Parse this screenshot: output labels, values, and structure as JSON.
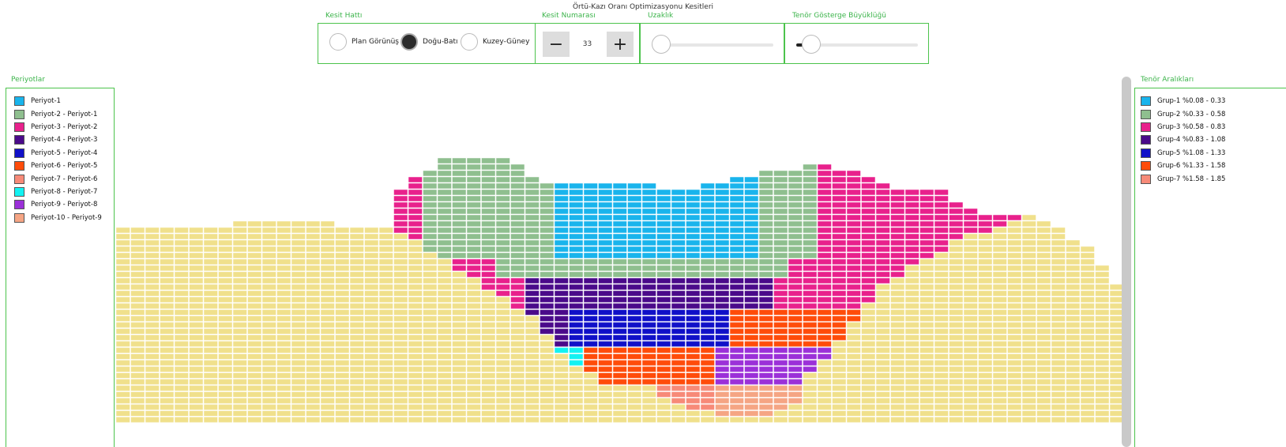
{
  "title": "Örtü-Kazı Oranı Optimizasyonu Kesitleri",
  "toolbar": {
    "section_line_label": "Kesit Hattı",
    "section_number_label": "Kesit Numarası",
    "distance_label": "Uzaklık",
    "grade_size_label": "Tenör Gösterge Büyüklüğü",
    "options": [
      "Plan Görünüş",
      "Doğu-Batı",
      "Kuzey-Güney"
    ],
    "selected_option": "Doğu-Batı",
    "section_number": "33",
    "minus_symbol": "−",
    "plus_symbol": "+",
    "distance_fraction": 0.0,
    "grade_size_fraction": 0.05
  },
  "periods": {
    "title": "Periyotlar",
    "items": [
      {
        "label": "Periyot-1",
        "color": "#19b4ec"
      },
      {
        "label": "Periyot-2 - Periyot-1",
        "color": "#8fbf8f"
      },
      {
        "label": "Periyot-3 - Periyot-2",
        "color": "#e8218c"
      },
      {
        "label": "Periyot-4 - Periyot-3",
        "color": "#4a0a8a"
      },
      {
        "label": "Periyot-5 - Periyot-4",
        "color": "#1010c8"
      },
      {
        "label": "Periyot-6 - Periyot-5",
        "color": "#ff4c0a"
      },
      {
        "label": "Periyot-7 - Periyot-6",
        "color": "#f78a78"
      },
      {
        "label": "Periyot-8 - Periyot-7",
        "color": "#12f2f2"
      },
      {
        "label": "Periyot-9 - Periyot-8",
        "color": "#9b30d8"
      },
      {
        "label": "Periyot-10 - Periyot-9",
        "color": "#f5a584"
      }
    ]
  },
  "grades": {
    "title": "Tenör Aralıkları",
    "items": [
      {
        "label": "Grup-1 %0.08 - 0.33",
        "color": "#19b4ec"
      },
      {
        "label": "Grup-2 %0.33 - 0.58",
        "color": "#8fbf8f"
      },
      {
        "label": "Grup-3 %0.58 - 0.83",
        "color": "#e8218c"
      },
      {
        "label": "Grup-4 %0.83 - 1.08",
        "color": "#4a0a8a"
      },
      {
        "label": "Grup-5 %1.08 - 1.33",
        "color": "#1010c8"
      },
      {
        "label": "Grup-6 %1.33 - 1.58",
        "color": "#ff4c0a"
      },
      {
        "label": "Grup-7 %1.58 - 1.85",
        "color": "#f78a78"
      }
    ]
  },
  "colors": {
    "accent_green": "#4cc34c",
    "waste_block": "#f0e08c"
  }
}
